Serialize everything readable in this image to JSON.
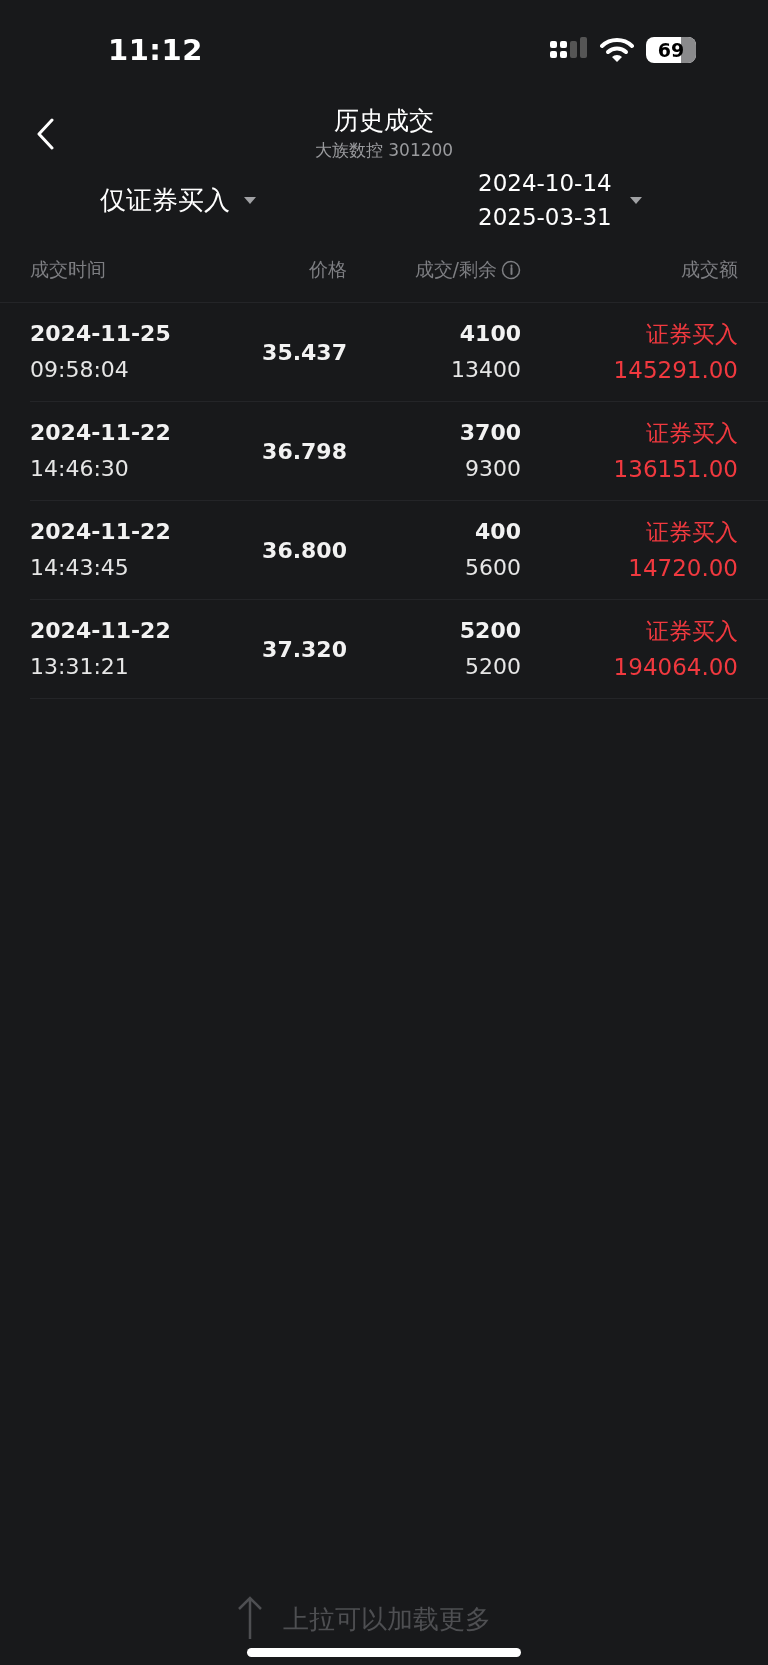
{
  "status_bar": {
    "time": "11:12",
    "battery": "69"
  },
  "header": {
    "title": "历史成交",
    "subtitle": "大族数控 301200"
  },
  "filters": {
    "type_filter": {
      "label": "仅证券买入"
    },
    "date_range": {
      "start": "2024-10-14",
      "end": "2025-03-31"
    }
  },
  "table": {
    "columns": [
      {
        "label": "成交时间",
        "info": false
      },
      {
        "label": "价格",
        "info": false
      },
      {
        "label": "成交/剩余",
        "info": true
      },
      {
        "label": "成交额",
        "info": false
      }
    ],
    "rows": [
      {
        "date": "2024-11-25",
        "time": "09:58:04",
        "price": "35.437",
        "filled": "4100",
        "remaining": "13400",
        "side": "证券买入",
        "amount": "145291.00"
      },
      {
        "date": "2024-11-22",
        "time": "14:46:30",
        "price": "36.798",
        "filled": "3700",
        "remaining": "9300",
        "side": "证券买入",
        "amount": "136151.00"
      },
      {
        "date": "2024-11-22",
        "time": "14:43:45",
        "price": "36.800",
        "filled": "400",
        "remaining": "5600",
        "side": "证券买入",
        "amount": "14720.00"
      },
      {
        "date": "2024-11-22",
        "time": "13:31:21",
        "price": "37.320",
        "filled": "5200",
        "remaining": "5200",
        "side": "证券买入",
        "amount": "194064.00"
      }
    ]
  },
  "footer": {
    "hint": "上拉可以加载更多"
  }
}
